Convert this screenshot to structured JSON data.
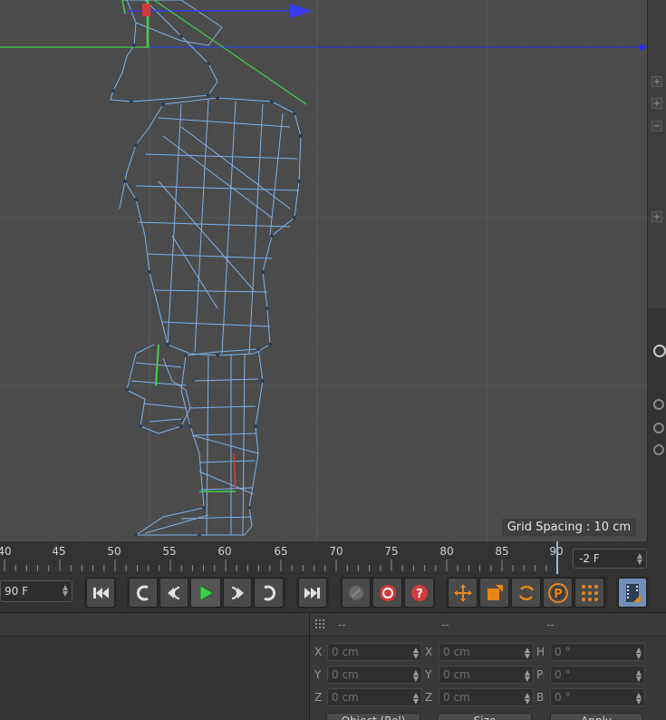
{
  "viewport": {
    "grid_spacing_label": "Grid Spacing : 10 cm"
  },
  "timeline": {
    "ticks": [
      "40",
      "45",
      "50",
      "55",
      "60",
      "65",
      "70",
      "75",
      "80",
      "85",
      "90"
    ],
    "current_frame": "-2 F",
    "min_frame": "90 F"
  },
  "transport": {
    "buttons": [
      {
        "name": "go-to-start-button",
        "icon": "skip-back-icon"
      },
      {
        "name": "previous-key-button",
        "icon": "prev-key-icon"
      },
      {
        "name": "previous-frame-button",
        "icon": "step-back-icon"
      },
      {
        "name": "play-button",
        "icon": "play-icon"
      },
      {
        "name": "next-frame-button",
        "icon": "step-forward-icon"
      },
      {
        "name": "next-key-button",
        "icon": "next-key-icon"
      },
      {
        "name": "go-to-end-button",
        "icon": "skip-forward-icon"
      },
      {
        "name": "record-keys-button",
        "icon": "key-icon"
      },
      {
        "name": "autokey-button",
        "icon": "record-icon"
      },
      {
        "name": "keyframe-selection-button",
        "icon": "help-icon"
      },
      {
        "name": "record-position-button",
        "icon": "move-icon"
      },
      {
        "name": "record-scale-button",
        "icon": "scale-icon"
      },
      {
        "name": "record-rotation-button",
        "icon": "rotate-icon"
      },
      {
        "name": "record-parameter-button",
        "icon": "parameter-icon"
      },
      {
        "name": "record-point-level-button",
        "icon": "points-icon"
      },
      {
        "name": "timeline-scheme-button",
        "icon": "film-icon"
      }
    ],
    "accent_orange": "#e8861a",
    "accent_red": "#d33a3a",
    "accent_green": "#3fd14a"
  },
  "coordinates": {
    "header": [
      "--",
      "--",
      "--"
    ],
    "rows": [
      {
        "pos_label": "X",
        "pos": "0 cm",
        "size_label": "X",
        "size": "0 cm",
        "rot_label": "H",
        "rot": "0 °"
      },
      {
        "pos_label": "Y",
        "pos": "0 cm",
        "size_label": "Y",
        "size": "0 cm",
        "rot_label": "P",
        "rot": "0 °"
      },
      {
        "pos_label": "Z",
        "pos": "0 cm",
        "size_label": "Z",
        "size": "0 cm",
        "rot_label": "B",
        "rot": "0 °"
      }
    ],
    "mode_select": "Object (Rel)",
    "size_select": "Size",
    "apply_button": "Apply"
  },
  "colors": {
    "viewport_bg": "#4b4b4b",
    "mesh": "#7fb2ea",
    "axis_x": "#3a3af0",
    "axis_y": "#3fd14a"
  }
}
